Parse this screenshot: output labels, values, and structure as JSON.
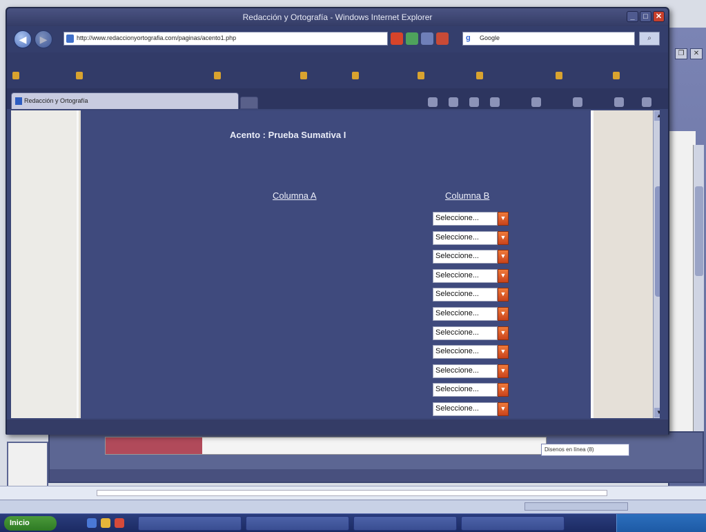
{
  "window": {
    "title": "Redacción y Ortografía - Windows Internet Explorer",
    "url": "http://www.redaccionyortografia.com/paginas/acento1.php",
    "search_engine": "Google",
    "tab_label": "Redacción y Ortografía"
  },
  "page": {
    "title": "Acento : Prueba Sumativa I",
    "column_a_header": "Columna A",
    "column_b_header": "Columna B",
    "select_placeholder": "Seleccione...",
    "select_count": 11
  },
  "background": {
    "search_pill": "Disenos en línea (8)"
  },
  "taskbar": {
    "start_label": "Inicio"
  },
  "colors": {
    "page_panel": "#3f4a7d",
    "select_arrow": "#e0602a",
    "window_chrome": "#343c66"
  }
}
